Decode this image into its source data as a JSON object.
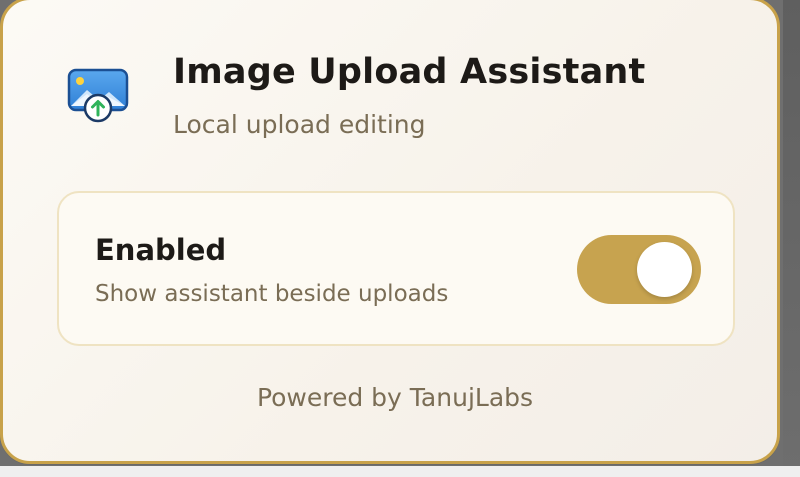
{
  "header": {
    "title": "Image Upload Assistant",
    "subtitle": "Local upload editing",
    "icon": "image-upload-icon"
  },
  "setting": {
    "title": "Enabled",
    "description": "Show assistant beside uploads",
    "enabled": true
  },
  "footer": {
    "text": "Powered by TanujLabs"
  },
  "colors": {
    "accent": "#c7a34f",
    "border": "#c8a24a",
    "muted_text": "#7a6d55",
    "primary_text": "#1d1a17"
  }
}
